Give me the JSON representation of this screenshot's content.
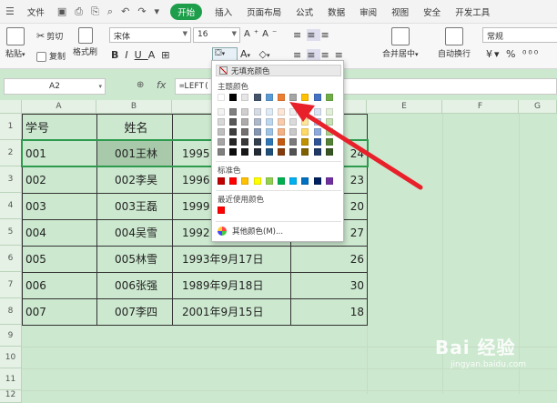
{
  "menubar": {
    "file": "文件",
    "tabs": [
      "开始",
      "插入",
      "页面布局",
      "公式",
      "数据",
      "审阅",
      "视图",
      "安全",
      "开发工具"
    ],
    "active_tab_index": 0
  },
  "ribbon": {
    "paste": "粘贴",
    "cut": "剪切",
    "copy": "复制",
    "format_painter": "格式刷",
    "font_name": "宋体",
    "font_size": "16",
    "merge_center": "合并居中",
    "wrap_text": "自动换行",
    "number_format": "常规"
  },
  "formula_bar": {
    "name_box": "A2",
    "fx": "fx",
    "formula": "=LEFT("
  },
  "sheet": {
    "columns": [
      "A",
      "B",
      "C",
      "D",
      "E",
      "F",
      "G"
    ],
    "rows": [
      "1",
      "2",
      "3",
      "4",
      "5",
      "6",
      "7",
      "8",
      "9",
      "10",
      "11",
      "12"
    ],
    "header": [
      "学号",
      "姓名",
      "出",
      ""
    ],
    "data": [
      [
        "001",
        "001王林",
        "1995",
        "24"
      ],
      [
        "002",
        "002李昊",
        "1996",
        "23"
      ],
      [
        "003",
        "003王磊",
        "1999",
        "20"
      ],
      [
        "004",
        "004吴雪",
        "1992",
        "27"
      ],
      [
        "005",
        "005林雪",
        "1993年9月17日",
        "26"
      ],
      [
        "006",
        "006张强",
        "1989年9月18日",
        "30"
      ],
      [
        "007",
        "007李四",
        "2001年9月15日",
        "18"
      ]
    ]
  },
  "fill_popup": {
    "no_fill": "无填充颜色",
    "theme_colors_label": "主题颜色",
    "standard_colors_label": "标准色",
    "recent_colors_label": "最近使用颜色",
    "more_colors": "其他颜色(M)...",
    "theme_top": [
      "#ffffff",
      "#000000",
      "#e7e6e6",
      "#44546a",
      "#5b9bd5",
      "#ed7d31",
      "#a5a5a5",
      "#ffc000",
      "#4472c4",
      "#70ad47"
    ],
    "theme_shades": [
      [
        "#f2f2f2",
        "#808080",
        "#d0cece",
        "#d6dce4",
        "#deebf6",
        "#fbe5d5",
        "#ededed",
        "#fff2cc",
        "#dae3f3",
        "#e2efd9"
      ],
      [
        "#d8d8d8",
        "#595959",
        "#aeabab",
        "#adb9ca",
        "#bdd7ee",
        "#f7cbac",
        "#dbdbdb",
        "#fee599",
        "#b4c6e7",
        "#c5e0b3"
      ],
      [
        "#bfbfbf",
        "#3f3f3f",
        "#757070",
        "#8496b0",
        "#9cc3e5",
        "#f4b183",
        "#c9c9c9",
        "#ffd965",
        "#8eaadb",
        "#a8d08d"
      ],
      [
        "#a5a5a5",
        "#262626",
        "#3a3838",
        "#323f4f",
        "#2e75b5",
        "#c55a11",
        "#7b7b7b",
        "#bf9000",
        "#2f5496",
        "#538135"
      ],
      [
        "#7f7f7f",
        "#0c0c0c",
        "#171616",
        "#222a35",
        "#1e4e79",
        "#833c0b",
        "#525252",
        "#7f6000",
        "#1f3864",
        "#375623"
      ]
    ],
    "standard": [
      "#c00000",
      "#ff0000",
      "#ffc000",
      "#ffff00",
      "#92d050",
      "#00b050",
      "#00b0f0",
      "#0070c0",
      "#002060",
      "#7030a0"
    ],
    "recent": [
      "#ff0000"
    ]
  },
  "watermark": {
    "logo": "Bai 经验",
    "url": "jingyan.baidu.com"
  },
  "colors": {
    "accent": "#1e9e4a",
    "sheet_bg": "#cce8cf",
    "arrow": "#e8202a"
  }
}
